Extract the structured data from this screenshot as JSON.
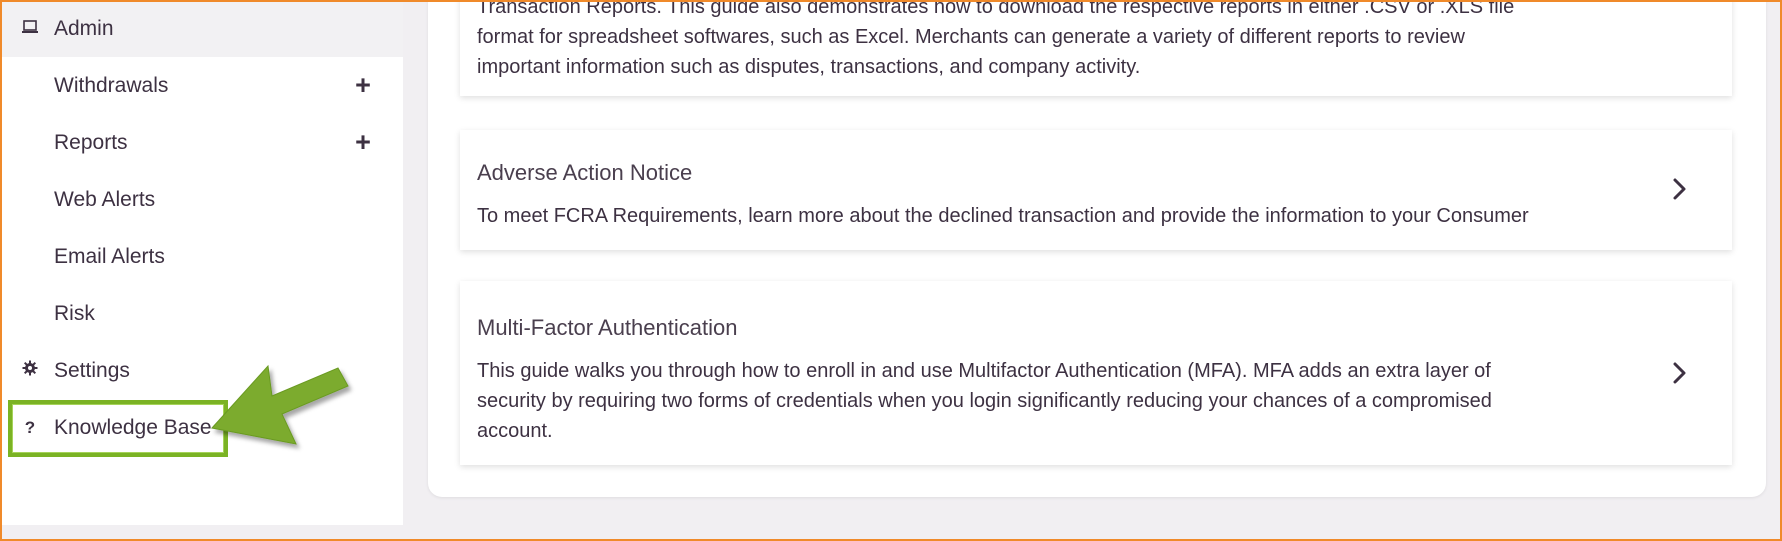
{
  "sidebar": {
    "items": [
      {
        "label": "Admin",
        "icon": "laptop-icon",
        "active": true
      },
      {
        "label": "Withdrawals",
        "expandable": true
      },
      {
        "label": "Reports",
        "expandable": true
      },
      {
        "label": "Web Alerts"
      },
      {
        "label": "Email Alerts"
      },
      {
        "label": "Risk"
      },
      {
        "label": "Settings",
        "icon": "gear-icon"
      },
      {
        "label": "Knowledge Base",
        "icon": "question-icon",
        "highlighted": true
      }
    ],
    "plus_symbol": "+",
    "question_symbol": "?"
  },
  "articles": [
    {
      "title": "",
      "desc_lines": [
        "Transaction Reports. This guide also demonstrates how to download the respective reports in either .CSV or .XLS file",
        "format for spreadsheet softwares, such as Excel. Merchants can generate a variety of different reports to review",
        "important information such as disputes, transactions, and company activity."
      ]
    },
    {
      "title": "Adverse Action Notice",
      "desc_lines": [
        "To meet FCRA Requirements, learn more about the declined transaction and provide the information to your Consumer"
      ]
    },
    {
      "title": "Multi-Factor Authentication",
      "desc_lines": [
        "This guide walks you through how to enroll in and use Multifactor Authentication (MFA). MFA adds an extra layer of",
        "security by requiring two forms of credentials when you login significantly reducing your chances of a compromised",
        "account."
      ]
    }
  ],
  "colors": {
    "highlight": "#7bb324",
    "frame": "#f08a2a"
  }
}
